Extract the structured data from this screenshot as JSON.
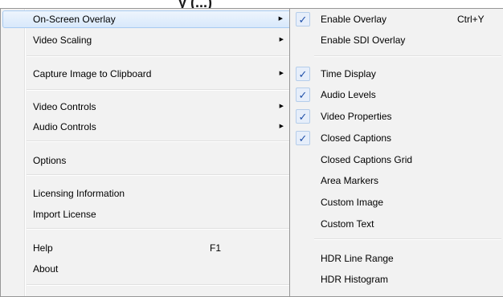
{
  "background_title": "y (...)",
  "main_menu": {
    "items": [
      {
        "label": "On-Screen Overlay",
        "has_submenu": true,
        "highlighted": true
      },
      {
        "label": "Video Scaling",
        "has_submenu": true
      },
      {
        "label": "Capture Image to Clipboard",
        "has_submenu": true
      },
      {
        "label": "Video Controls",
        "has_submenu": true
      },
      {
        "label": "Audio Controls",
        "has_submenu": true
      },
      {
        "label": "Options"
      },
      {
        "label": "Licensing Information"
      },
      {
        "label": "Import License"
      },
      {
        "label": "Help",
        "shortcut": "F1"
      },
      {
        "label": "About"
      }
    ]
  },
  "sub_menu": {
    "items": [
      {
        "label": "Enable Overlay",
        "checked": true,
        "shortcut": "Ctrl+Y"
      },
      {
        "label": "Enable SDI Overlay",
        "checked": false
      },
      {
        "label": "Time Display",
        "checked": true
      },
      {
        "label": "Audio Levels",
        "checked": true
      },
      {
        "label": "Video Properties",
        "checked": true
      },
      {
        "label": "Closed Captions",
        "checked": true
      },
      {
        "label": "Closed Captions Grid",
        "checked": false
      },
      {
        "label": "Area Markers",
        "checked": false
      },
      {
        "label": "Custom Image",
        "checked": false
      },
      {
        "label": "Custom Text",
        "checked": false
      },
      {
        "label": "HDR Line Range",
        "checked": false
      },
      {
        "label": "HDR Histogram",
        "checked": false
      }
    ]
  },
  "glyphs": {
    "submenu_arrow": "▶",
    "check": "✓"
  },
  "colors": {
    "highlight_border": "#a8cbf1",
    "check_color": "#1f4fa8",
    "menu_bg": "#f2f2f2"
  }
}
